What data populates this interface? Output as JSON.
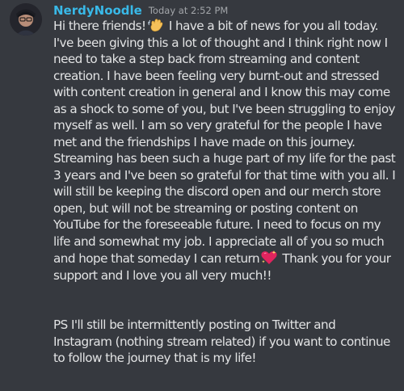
{
  "message": {
    "username": "NerdyNoodle",
    "timestamp": "Today at 2:52 PM",
    "para1_part1": "Hi there friends!",
    "para1_part2": " I have a bit of news for you all today. I've been giving this a lot of thought and I think right now I need to take a step back from streaming and content creation. I have been feeling very burnt-out and stressed with content creation in general and I know this may come as a shock to some of you, but I've been struggling to enjoy myself as well. I am so very grateful for the people I have met and the friendships I have made on this journey. Streaming has been such a huge part of my life for the past 3 years and I've been so grateful for that time with you all. I will still be keeping the discord open and our merch store open, but will not be streaming or posting content on YouTube for the foreseeable future. I need to focus on my life and somewhat my job. I appreciate all of you so much and hope that someday I can return",
    "para1_part3": " Thank you for your support and I love you all very much!!",
    "para2": "PS I'll still be intermittently posting on Twitter and Instagram (nothing stream related) if you want to continue to follow the journey that is my life!",
    "emojis": [
      "waving-hand",
      "sparkling-heart"
    ]
  },
  "colors": {
    "background": "#36393f",
    "username": "#39b9e8",
    "text": "#dcddde",
    "timestamp": "#a3a6aa"
  }
}
